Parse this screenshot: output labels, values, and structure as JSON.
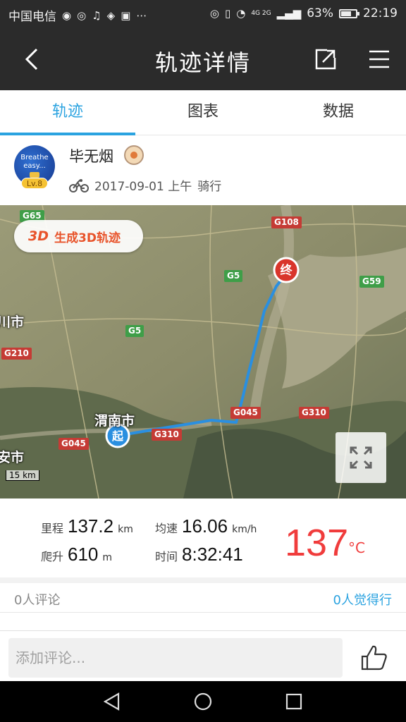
{
  "status_bar": {
    "carrier": "中国电信",
    "battery": "63%",
    "battery_level": 0.63,
    "time": "22:19",
    "network": "4G 2G"
  },
  "header": {
    "title": "轨迹详情",
    "icons": [
      "back-icon",
      "share-icon",
      "menu-icon"
    ]
  },
  "tabs": [
    {
      "label": "轨迹",
      "active": true
    },
    {
      "label": "图表",
      "active": false
    },
    {
      "label": "数据",
      "active": false
    }
  ],
  "user": {
    "name": "毕无烟",
    "avatar_text": "Breathe easy...",
    "level": "Lv.8",
    "date": "2017-09-01 上午",
    "activity": "骑行"
  },
  "map": {
    "btn_3d_badge": "3D",
    "btn_3d_label": "生成3D轨迹",
    "start_marker": "起",
    "end_marker": "终",
    "scale": "15 km",
    "roads": [
      {
        "label": "G65",
        "color": "#3f9e48"
      },
      {
        "label": "G108",
        "color": "#c53b35"
      },
      {
        "label": "G5",
        "color": "#3f9e48"
      },
      {
        "label": "G59",
        "color": "#3f9e48"
      },
      {
        "label": "G5",
        "color": "#3f9e48"
      },
      {
        "label": "G210",
        "color": "#c53b35"
      },
      {
        "label": "G045",
        "color": "#c53b35"
      },
      {
        "label": "G310",
        "color": "#c53b35"
      },
      {
        "label": "G310",
        "color": "#c53b35"
      },
      {
        "label": "G045",
        "color": "#c53b35"
      }
    ],
    "cities": [
      "渭南市",
      "安市",
      "川市"
    ]
  },
  "stats": {
    "distance_label": "里程",
    "distance_value": "137.2",
    "distance_unit": "km",
    "speed_label": "均速",
    "speed_value": "16.06",
    "speed_unit": "km/h",
    "climb_label": "爬升",
    "climb_value": "610",
    "climb_unit": "m",
    "time_label": "时间",
    "time_value": "8:32:41",
    "temperature_value": "137",
    "temperature_unit": "°C"
  },
  "social": {
    "comments": "0人评论",
    "likes": "0人觉得行"
  },
  "comment_bar": {
    "placeholder": "添加评论..."
  },
  "colors": {
    "accent": "#2ba3e0",
    "header_bg": "#2b2b2b",
    "temperature": "#f03c3c",
    "track": "#2a8fe0"
  }
}
